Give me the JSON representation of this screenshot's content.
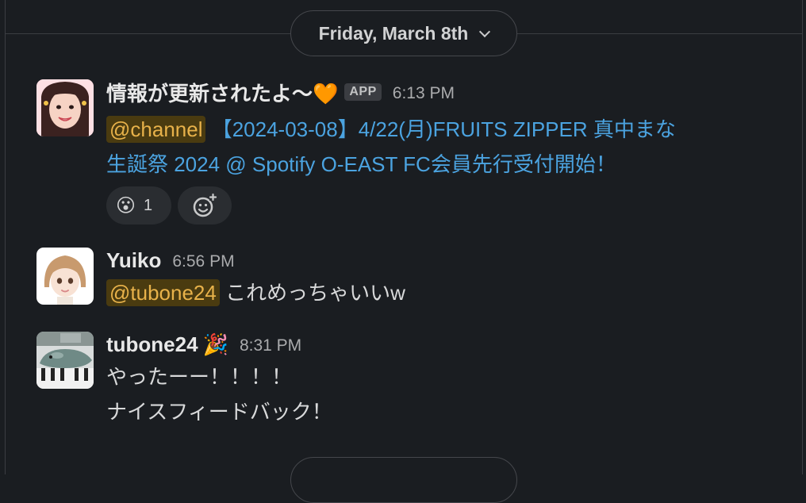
{
  "date_divider": {
    "label": "Friday, March 8th"
  },
  "messages": [
    {
      "sender": "情報が更新されたよ〜🧡",
      "badge": "APP",
      "time": "6:13 PM",
      "mention": "@channel",
      "link_line1": " 【2024-03-08】4/22(月)FRUITS ZIPPER 真中まな",
      "link_line2": "生誕祭 2024 @ Spotify O-EAST FC会員先行受付開始！",
      "reaction_emoji": "😮",
      "reaction_count": "1"
    },
    {
      "sender": "Yuiko",
      "time": "6:56 PM",
      "mention": "@tubone24",
      "text": " これめっちゃいいw"
    },
    {
      "sender": "tubone24",
      "status_emoji": "🎉",
      "time": "8:31 PM",
      "line1": "やったーー！！！！",
      "line2": "ナイスフィードバック！"
    }
  ],
  "colors": {
    "background": "#1a1d21",
    "link": "#4ba3e0",
    "mention_text": "#e8b24a",
    "mention_bg": "#4a3b10"
  }
}
